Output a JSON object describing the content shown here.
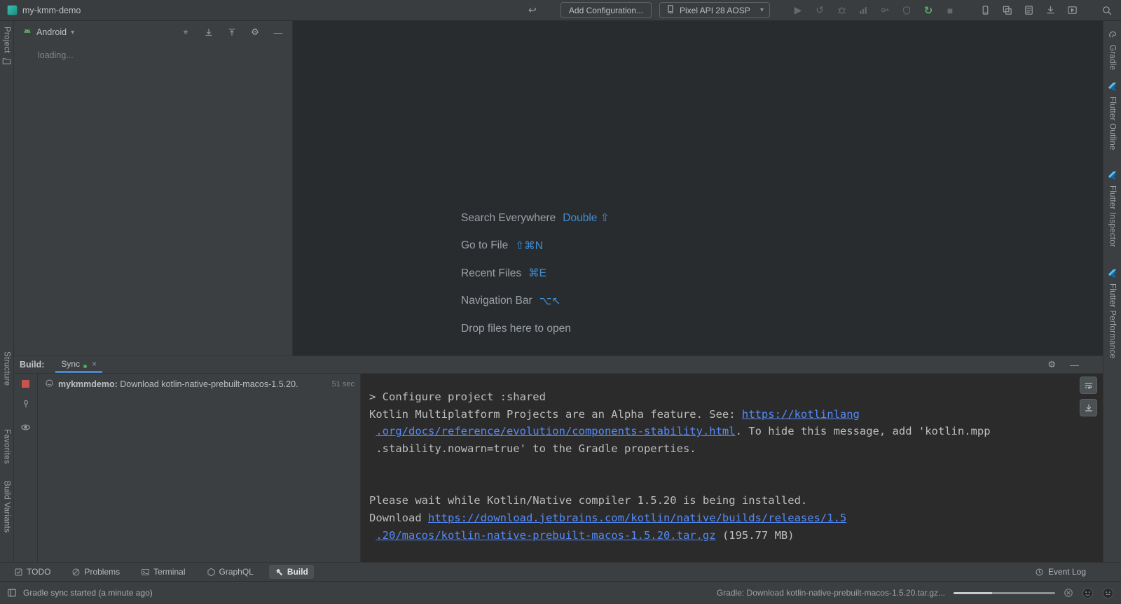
{
  "colors": {
    "accent_blue": "#4a88c7",
    "shortcut_key_blue": "#3f8fd8",
    "link_blue": "#548af7",
    "green": "#4db056",
    "stop_red": "#c75450",
    "panel_bg": "#3c3f41",
    "editor_bg": "#292c2e",
    "console_bg": "#2b2b2b"
  },
  "icons": {
    "back": "↩",
    "run": "▶",
    "stop": "■",
    "sync": "↻",
    "apply": "↺",
    "gear": "⚙",
    "minus": "—",
    "close": "×",
    "dropdown": "▾",
    "locate": "⌖"
  },
  "title_bar": {
    "window_title": "my-kmm-demo",
    "add_configuration_label": "Add Configuration...",
    "device_selector_value": "Pixel API 28 AOSP"
  },
  "left_strip": {
    "project": "Project",
    "structure": "Structure",
    "favorites": "Favorites",
    "build_variants": "Build Variants"
  },
  "right_strip": {
    "gradle": "Gradle",
    "flutter_outline": "Flutter Outline",
    "flutter_inspector": "Flutter Inspector",
    "flutter_performance": "Flutter Performance"
  },
  "project_panel": {
    "view": "Android",
    "loading": "loading..."
  },
  "editor": {
    "shortcuts": [
      {
        "label": "Search Everywhere",
        "keys": "Double ⇧"
      },
      {
        "label": "Go to File",
        "keys": "⇧⌘N"
      },
      {
        "label": "Recent Files",
        "keys": "⌘E"
      },
      {
        "label": "Navigation Bar",
        "keys": "⌥↖"
      },
      {
        "label": "Drop files here to open",
        "keys": ""
      }
    ]
  },
  "build_panel": {
    "title": "Build:",
    "tab_label": "Sync",
    "tree_item": {
      "bold": "mykmmdemo:",
      "text": " Download kotlin-native-prebuilt-macos-1.5.20.",
      "duration": "51 sec"
    },
    "console_lines": [
      [
        {
          "t": "text",
          "s": "> Configure project :shared"
        }
      ],
      [
        {
          "t": "text",
          "s": "Kotlin Multiplatform Projects are an Alpha feature. See: "
        },
        {
          "t": "link",
          "s": "https://kotlinlang"
        }
      ],
      [
        {
          "t": "text",
          "s": " "
        },
        {
          "t": "link",
          "s": ".org/docs/reference/evolution/components-stability.html"
        },
        {
          "t": "text",
          "s": ". To hide this message, add 'kotlin.mpp"
        }
      ],
      [
        {
          "t": "text",
          "s": " .stability.nowarn=true' to the Gradle properties."
        }
      ],
      [],
      [],
      [
        {
          "t": "text",
          "s": "Please wait while Kotlin/Native compiler 1.5.20 is being installed."
        }
      ],
      [
        {
          "t": "text",
          "s": "Download "
        },
        {
          "t": "link",
          "s": "https://download.jetbrains.com/kotlin/native/builds/releases/1.5"
        }
      ],
      [
        {
          "t": "text",
          "s": " "
        },
        {
          "t": "link",
          "s": ".20/macos/kotlin-native-prebuilt-macos-1.5.20.tar.gz"
        },
        {
          "t": "text",
          "s": " (195.77 MB)"
        }
      ]
    ]
  },
  "bottom_bar": {
    "todo": "TODO",
    "problems": "Problems",
    "terminal": "Terminal",
    "graphql": "GraphQL",
    "build": "Build",
    "event_log": "Event Log"
  },
  "status_bar": {
    "left_text": "Gradle sync started (a minute ago)",
    "progress_text": "Gradle: Download kotlin-native-prebuilt-macos-1.5.20.tar.gz..."
  }
}
